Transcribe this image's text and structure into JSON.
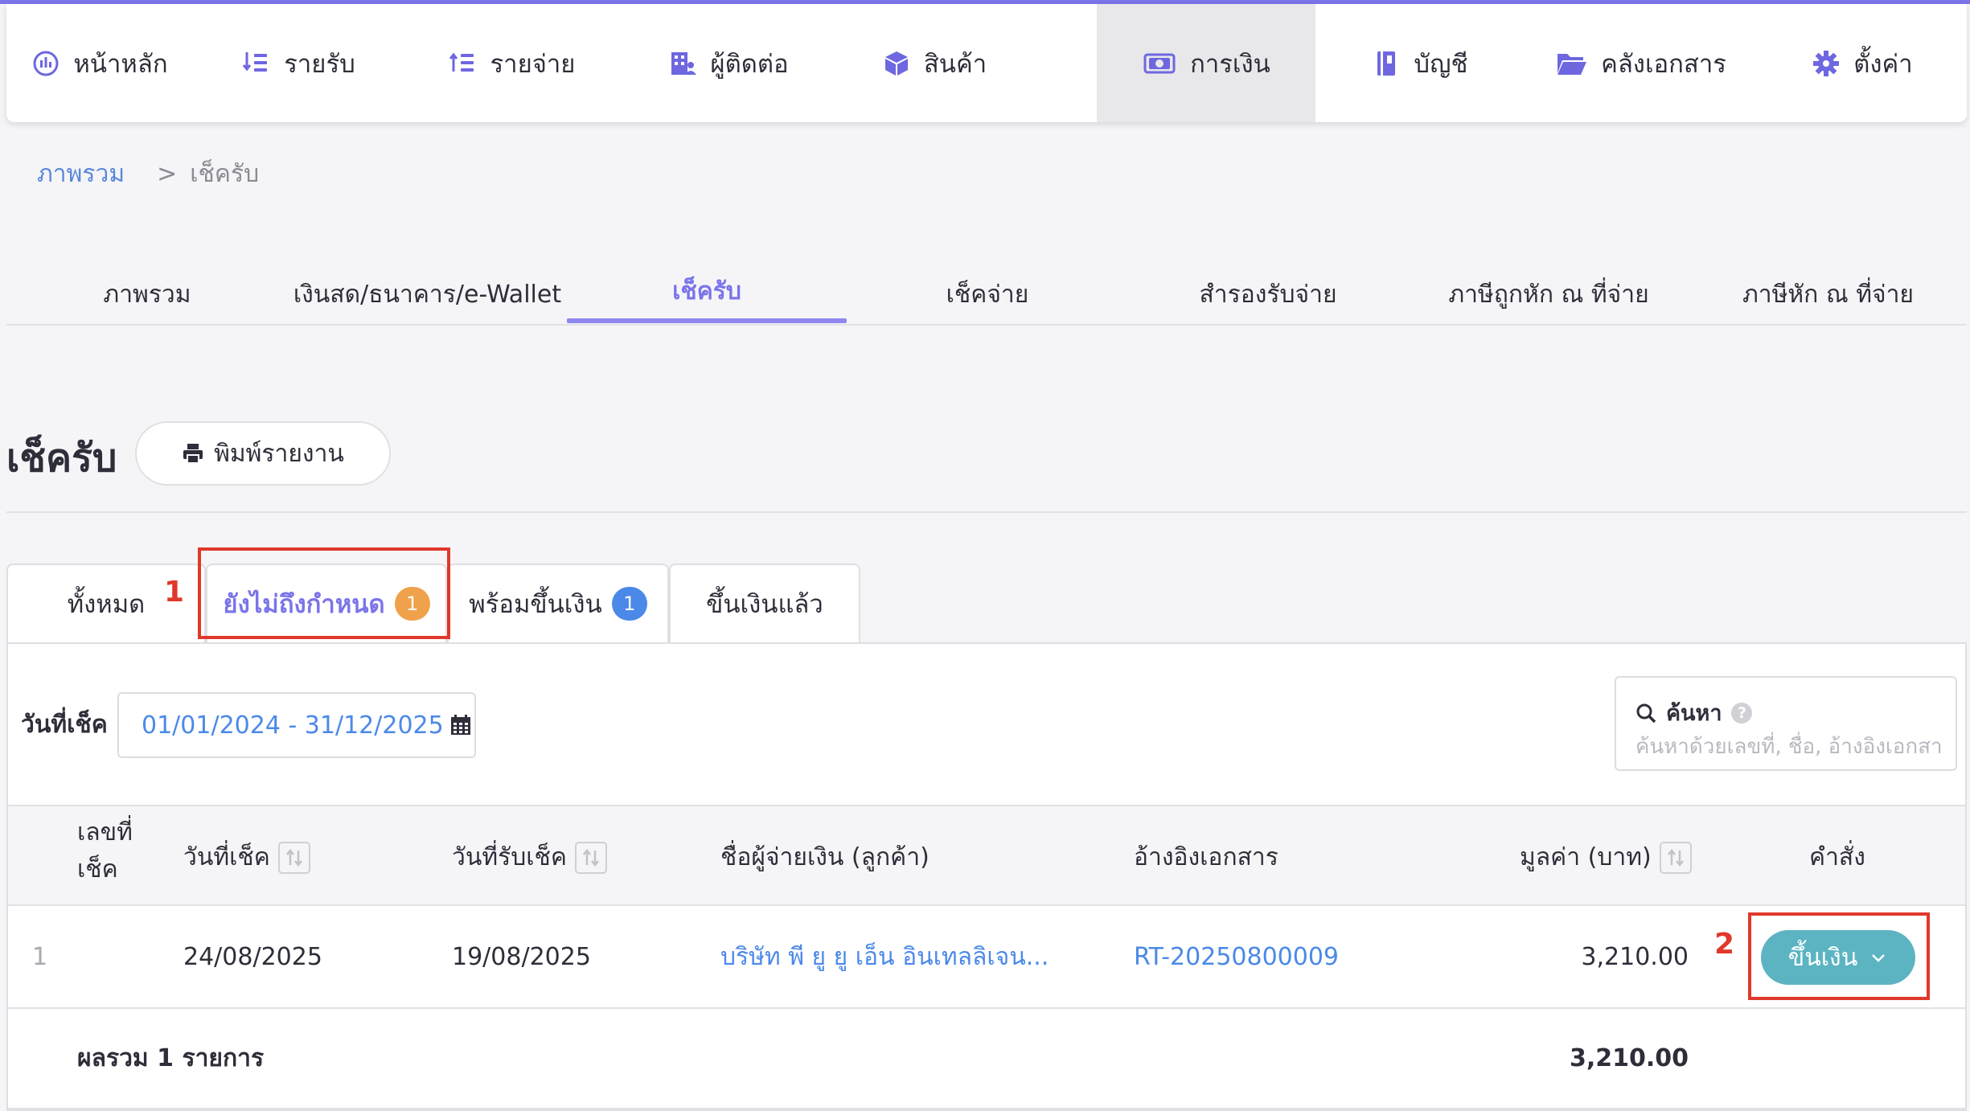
{
  "colors": {
    "accent": "#7b74ea",
    "link": "#4b89e8",
    "deposit_button": "#5cb4c2",
    "badge_orange": "#f0a14b",
    "badge_blue": "#4b89e8",
    "callout_red": "#e0382a"
  },
  "nav": {
    "items": [
      {
        "label": "หน้าหลัก",
        "icon": "dashboard-icon"
      },
      {
        "label": "รายรับ",
        "icon": "income-list-icon"
      },
      {
        "label": "รายจ่าย",
        "icon": "expense-list-icon"
      },
      {
        "label": "ผู้ติดต่อ",
        "icon": "contacts-building-icon"
      },
      {
        "label": "สินค้า",
        "icon": "product-box-icon"
      },
      {
        "label": "การเงิน",
        "icon": "money-icon",
        "active": true
      },
      {
        "label": "บัญชี",
        "icon": "ledger-book-icon"
      },
      {
        "label": "คลังเอกสาร",
        "icon": "folder-icon"
      },
      {
        "label": "ตั้งค่า",
        "icon": "gear-icon"
      }
    ]
  },
  "breadcrumb": {
    "home": "ภาพรวม",
    "separator": ">",
    "current": "เช็ครับ"
  },
  "section_tabs": [
    {
      "label": "ภาพรวม"
    },
    {
      "label": "เงินสด/ธนาคาร/e-Wallet"
    },
    {
      "label": "เช็ครับ",
      "active": true
    },
    {
      "label": "เช็คจ่าย"
    },
    {
      "label": "สำรองรับจ่าย"
    },
    {
      "label": "ภาษีถูกหัก ณ ที่จ่าย"
    },
    {
      "label": "ภาษีหัก ณ ที่จ่าย"
    }
  ],
  "page": {
    "title": "เช็ครับ",
    "print_button": "พิมพ์รายงาน",
    "print_icon": "printer-icon"
  },
  "status_tabs": [
    {
      "label": "ทั้งหมด",
      "badge": null
    },
    {
      "label": "ยังไม่ถึงกำหนด",
      "badge": "1",
      "active": true
    },
    {
      "label": "พร้อมขึ้นเงิน",
      "badge": "1"
    },
    {
      "label": "ขึ้นเงินแล้ว",
      "badge": null
    }
  ],
  "annotations": {
    "step1": "1",
    "step2": "2"
  },
  "filters": {
    "date_label": "วันที่เช็ค",
    "date_range": "01/01/2024 - 31/12/2025",
    "calendar_icon": "calendar-icon",
    "search_title": "ค้นหา",
    "search_help": "?",
    "search_placeholder": "ค้นหาด้วยเลขที่, ชื่อ, อ้างอิงเอกสาร"
  },
  "table": {
    "columns": {
      "cheque_no_line1": "เลขที่",
      "cheque_no_line2": "เช็ค",
      "cheque_date": "วันที่เช็ค",
      "received_date": "วันที่รับเช็ค",
      "payer": "ชื่อผู้จ่ายเงิน (ลูกค้า)",
      "reference": "อ้างอิงเอกสาร",
      "amount": "มูลค่า (บาท)",
      "action": "คำสั่ง"
    },
    "rows": [
      {
        "cheque_no": "1",
        "cheque_date": "24/08/2025",
        "received_date": "19/08/2025",
        "payer": "บริษัท พี ยู ยู เอ็น อินเทลลิเจน...",
        "reference": "RT-20250800009",
        "amount": "3,210.00",
        "action_label": "ขึ้นเงิน"
      }
    ],
    "footer": {
      "label": "ผลรวม 1 รายการ",
      "total": "3,210.00"
    }
  }
}
